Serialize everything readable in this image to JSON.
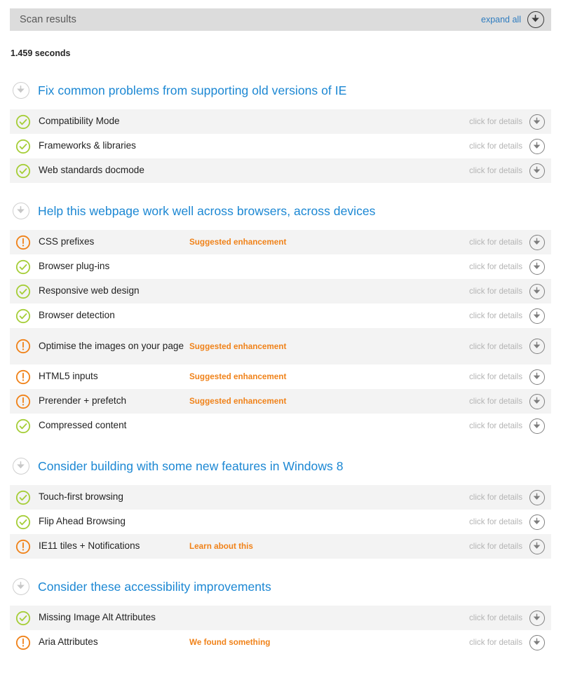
{
  "header": {
    "title": "Scan results",
    "expand_all_label": "expand all",
    "expand_icon": "download-circle-icon"
  },
  "elapsed": "1.459 seconds",
  "row_details_label": "click for details",
  "colors": {
    "heading_blue": "#1b87d3",
    "status_orange": "#f08219",
    "ok_green": "#a6ce39",
    "header_bar": "#dcdcdc",
    "row_shade": "#f3f3f3",
    "details_gray": "#b4b4b4"
  },
  "sections": [
    {
      "title": "Fix common problems from supporting old versions of IE",
      "rows": [
        {
          "title": "Compatibility Mode",
          "status": "ok",
          "badge": ""
        },
        {
          "title": "Frameworks & libraries",
          "status": "ok",
          "badge": ""
        },
        {
          "title": "Web standards docmode",
          "status": "ok",
          "badge": ""
        }
      ]
    },
    {
      "title": "Help this webpage work well across browsers, across devices",
      "rows": [
        {
          "title": "CSS prefixes",
          "status": "warning",
          "badge": "Suggested enhancement"
        },
        {
          "title": "Browser plug-ins",
          "status": "ok",
          "badge": ""
        },
        {
          "title": "Responsive web design",
          "status": "ok",
          "badge": ""
        },
        {
          "title": "Browser detection",
          "status": "ok",
          "badge": ""
        },
        {
          "title": "Optimise the images on your page",
          "status": "warning",
          "badge": "Suggested enhancement",
          "tall": true
        },
        {
          "title": "HTML5 inputs",
          "status": "warning",
          "badge": "Suggested enhancement"
        },
        {
          "title": "Prerender + prefetch",
          "status": "warning",
          "badge": "Suggested enhancement"
        },
        {
          "title": "Compressed content",
          "status": "ok",
          "badge": ""
        }
      ]
    },
    {
      "title": "Consider building with some new features in Windows 8",
      "rows": [
        {
          "title": "Touch-first browsing",
          "status": "ok",
          "badge": ""
        },
        {
          "title": "Flip Ahead Browsing",
          "status": "ok",
          "badge": ""
        },
        {
          "title": "IE11 tiles + Notifications",
          "status": "warning",
          "badge": "Learn about this"
        }
      ]
    },
    {
      "title": "Consider these accessibility improvements",
      "rows": [
        {
          "title": "Missing Image Alt Attributes",
          "status": "ok",
          "badge": ""
        },
        {
          "title": "Aria Attributes",
          "status": "warning",
          "badge": "We found something"
        }
      ]
    }
  ]
}
